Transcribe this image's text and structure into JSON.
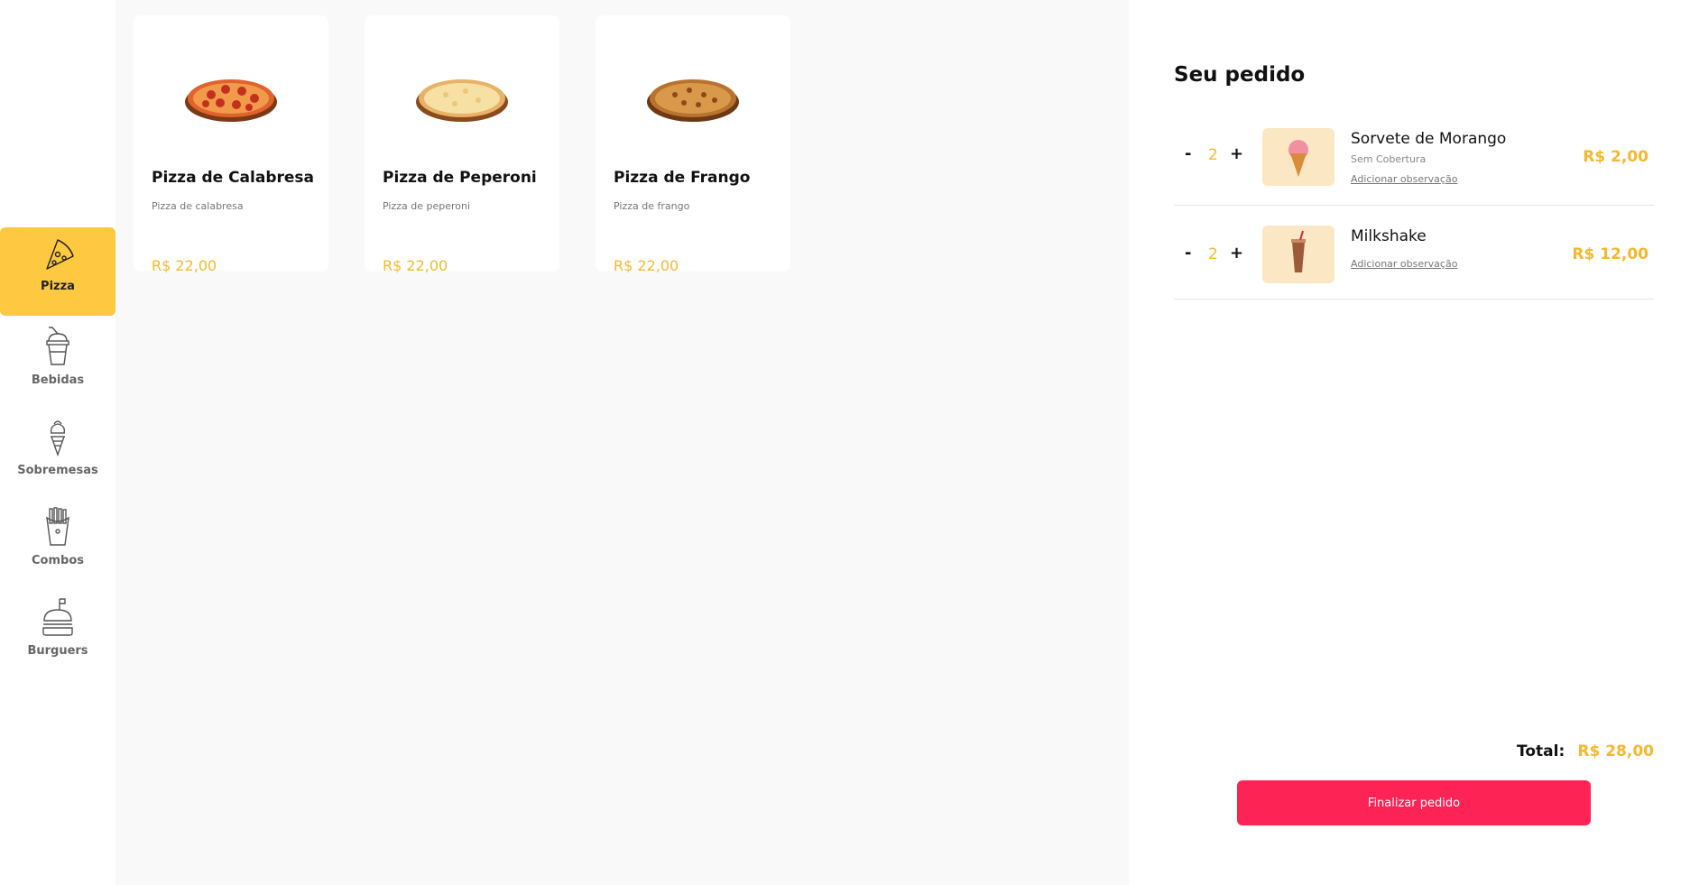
{
  "sidebar": {
    "items": [
      {
        "label": "Pizza",
        "icon": "pizza-slice-icon",
        "active": true
      },
      {
        "label": "Bebidas",
        "icon": "drink-cup-icon",
        "active": false
      },
      {
        "label": "Sobremesas",
        "icon": "ice-cream-icon",
        "active": false
      },
      {
        "label": "Combos",
        "icon": "fries-icon",
        "active": false
      },
      {
        "label": "Burguers",
        "icon": "burger-icon",
        "active": false
      }
    ]
  },
  "menu": {
    "products": [
      {
        "name": "Pizza de Calabresa",
        "description": "Pizza de calabresa",
        "price": "R$ 22,00",
        "image": "pepperoni-pizza"
      },
      {
        "name": "Pizza de Peperoni",
        "description": "Pizza de peperoni",
        "price": "R$ 22,00",
        "image": "cheese-pizza"
      },
      {
        "name": "Pizza de Frango",
        "description": "Pizza de frango",
        "price": "R$ 22,00",
        "image": "chicken-pizza"
      }
    ]
  },
  "order": {
    "title": "Seu pedido",
    "items": [
      {
        "name": "Sorvete de Morango",
        "subtitle": "Sem Cobertura",
        "observation_link": "Adicionar observação",
        "quantity": "2",
        "price": "R$ 2,00",
        "minus": "-",
        "plus": "+",
        "image": "strawberry-ice-cream"
      },
      {
        "name": "Milkshake",
        "observation_link": "Adicionar observação",
        "quantity": "2",
        "price": "R$ 12,00",
        "minus": "-",
        "plus": "+",
        "image": "milkshake"
      }
    ],
    "total_label": "Total:",
    "total_value": "R$ 28,00",
    "finish_button": "Finalizar pedido"
  },
  "colors": {
    "accent": "#fec840",
    "price": "#f5b82e",
    "button": "#fe2355",
    "main_bg": "#f9f9f9"
  }
}
